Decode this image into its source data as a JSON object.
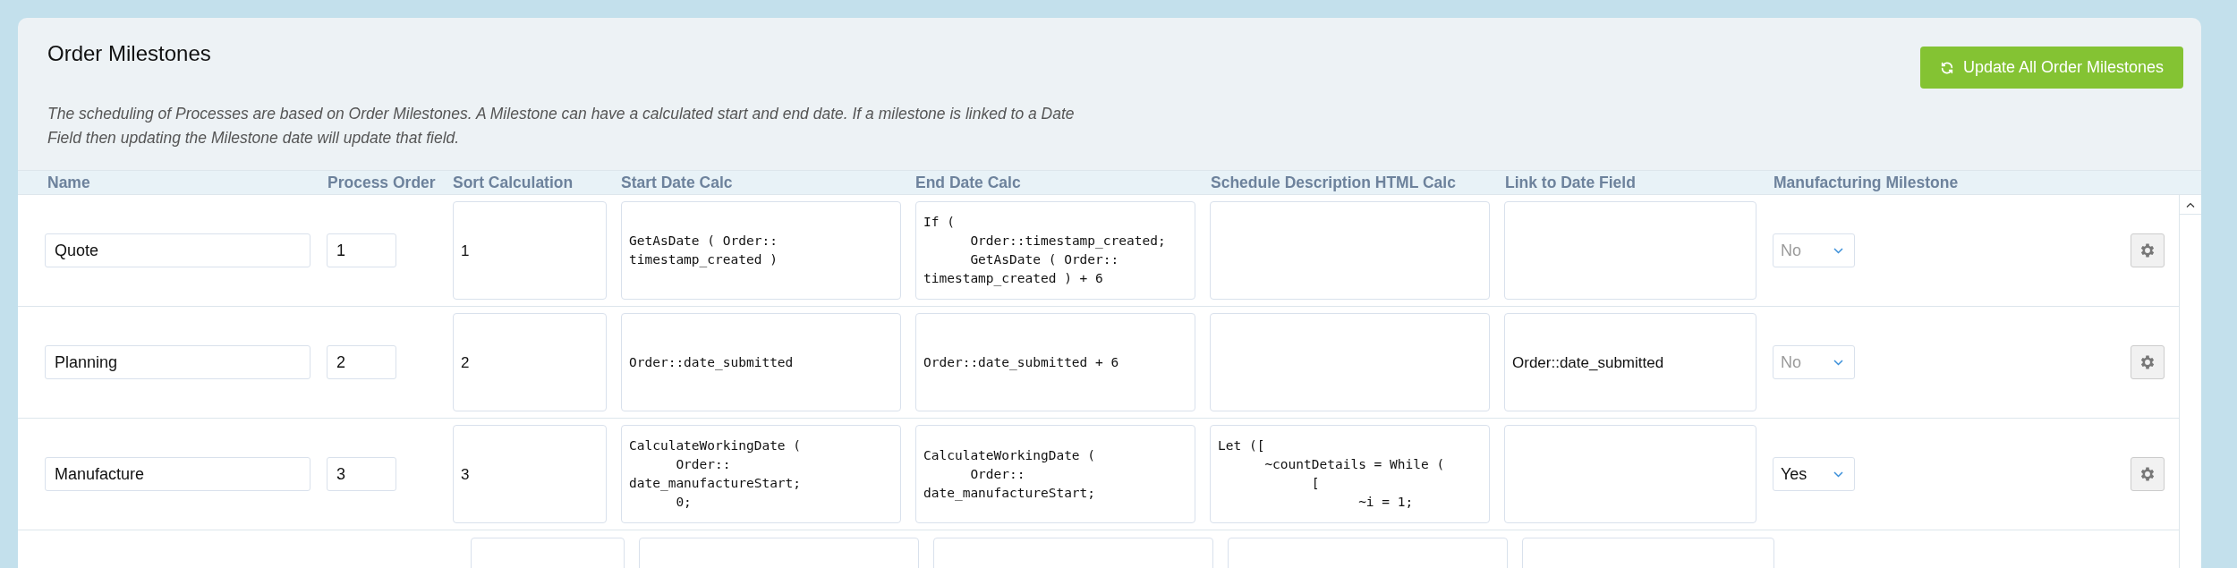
{
  "title": "Order Milestones",
  "update_button": {
    "label": "Update All Order Milestones"
  },
  "description": "The scheduling of Processes are based on Order Milestones. A Milestone can have a calculated start and end date. If a milestone is linked to a Date Field then updating the Milestone date will update that field.",
  "table": {
    "columns": [
      "Name",
      "Process Order",
      "Sort Calculation",
      "Start Date Calc",
      "End Date Calc",
      "Schedule Description HTML Calc",
      "Link to Date Field",
      "Manufacturing Milestone"
    ],
    "rows": [
      {
        "name": "Quote",
        "process_order": "1",
        "sort_calculation": "1",
        "start_date_calc": "GetAsDate ( Order::\ntimestamp_created )",
        "end_date_calc": "If (\n      Order::timestamp_created;\n      GetAsDate ( Order::\ntimestamp_created ) + 6",
        "schedule_description": "",
        "link_to_date_field": "",
        "manufacturing_milestone": {
          "value": "No",
          "disabled": true
        }
      },
      {
        "name": "Planning",
        "process_order": "2",
        "sort_calculation": "2",
        "start_date_calc": "Order::date_submitted",
        "end_date_calc": "Order::date_submitted + 6",
        "schedule_description": "",
        "link_to_date_field": "Order::date_submitted",
        "manufacturing_milestone": {
          "value": "No",
          "disabled": true
        }
      },
      {
        "name": "Manufacture",
        "process_order": "3",
        "sort_calculation": "3",
        "start_date_calc": "CalculateWorkingDate (\n      Order::\ndate_manufactureStart;\n      0;",
        "end_date_calc": "CalculateWorkingDate (\n      Order::\ndate_manufactureStart;",
        "schedule_description": "Let ([\n      ~countDetails = While (\n            [\n                  ~i = 1;",
        "link_to_date_field": "",
        "manufacturing_milestone": {
          "value": "Yes",
          "disabled": false
        }
      }
    ]
  }
}
